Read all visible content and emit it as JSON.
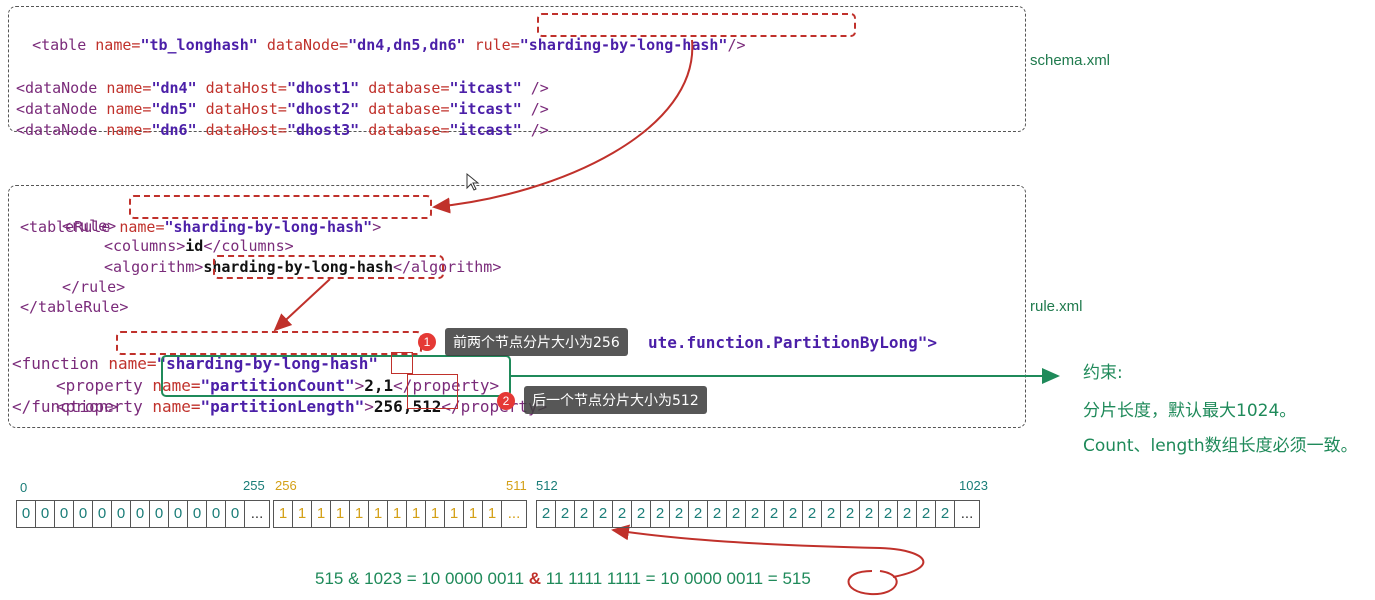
{
  "schema": {
    "line1": {
      "open": "<table ",
      "a1": "name=",
      "v1": "\"tb_longhash\"",
      "a2": " dataNode=",
      "v2": "\"dn4,dn5,dn6\"",
      "a3": " rule=",
      "v3": "\"sharding-by-long-hash\"",
      "close": "/>"
    },
    "datanodes": [
      {
        "open": "<dataNode ",
        "a1": "name=",
        "v1": "\"dn4\"",
        "a2": " dataHost=",
        "v2": "\"dhost1\"",
        "a3": " database=",
        "v3": "\"itcast\"",
        "close": " />"
      },
      {
        "open": "<dataNode ",
        "a1": "name=",
        "v1": "\"dn5\"",
        "a2": " dataHost=",
        "v2": "\"dhost2\"",
        "a3": " database=",
        "v3": "\"itcast\"",
        "close": " />"
      },
      {
        "open": "<dataNode ",
        "a1": "name=",
        "v1": "\"dn6\"",
        "a2": " dataHost=",
        "v2": "\"dhost3\"",
        "a3": " database=",
        "v3": "\"itcast\"",
        "close": " />"
      }
    ],
    "file_label": "schema.xml"
  },
  "rule": {
    "tableRule_open": "<tableRule ",
    "tableRule_attr": "name=",
    "tableRule_val": "\"sharding-by-long-hash\"",
    "tableRule_close": ">",
    "rule_open": "<rule>",
    "columns_open": "<columns>",
    "columns_val": "id",
    "columns_close": "</columns>",
    "algorithm_open": "<algorithm>",
    "algorithm_val": "sharding-by-long-hash",
    "algorithm_close": "</algorithm>",
    "rule_close": "</rule>",
    "tableRule_end": "</tableRule>",
    "function_open": "<function ",
    "function_attr": "name=",
    "function_val": "\"sharding-by-long-hash\"",
    "function_tail": "ute.function.PartitionByLong\">",
    "prop1_open": "<property ",
    "prop1_attr": "name=",
    "prop1_val": "\"partitionCount\"",
    "prop1_gt": ">",
    "prop1_text": "2,1",
    "prop1_close": "</property>",
    "prop2_open": "<property ",
    "prop2_attr": "name=",
    "prop2_val": "\"partitionLength\"",
    "prop2_gt": ">",
    "prop2_text": "256,512",
    "prop2_close": "</property>",
    "function_end": "</function>",
    "file_label": "rule.xml"
  },
  "tooltips": [
    {
      "badge": "1",
      "text": "前两个节点分片大小为256"
    },
    {
      "badge": "2",
      "text": "后一个节点分片大小为512"
    }
  ],
  "notes": {
    "title": "约束:",
    "line1": "分片长度，默认最大1024。",
    "line2": "Count、length数组长度必须一致。"
  },
  "partitions": [
    {
      "start": "0",
      "end": "255",
      "digit": "0",
      "count": 12,
      "color": "#1a7d78"
    },
    {
      "start": "256",
      "end": "511",
      "digit": "1",
      "count": 12,
      "color": "#d4a017"
    },
    {
      "start": "512",
      "end": "1023",
      "digit": "2",
      "count": 22,
      "color": "#1a7d78"
    }
  ],
  "ellipsis": "...",
  "formula": {
    "part1": "515 & 1023 = 10 0000 0011 ",
    "amp": "&",
    "part2": " 11 1111 1111 = 10 0000 0011 = ",
    "result": "515"
  },
  "colors": {
    "red": "#c0312b",
    "green": "#1f8a5a",
    "teal": "#1a7d78",
    "gold": "#d4a017"
  }
}
